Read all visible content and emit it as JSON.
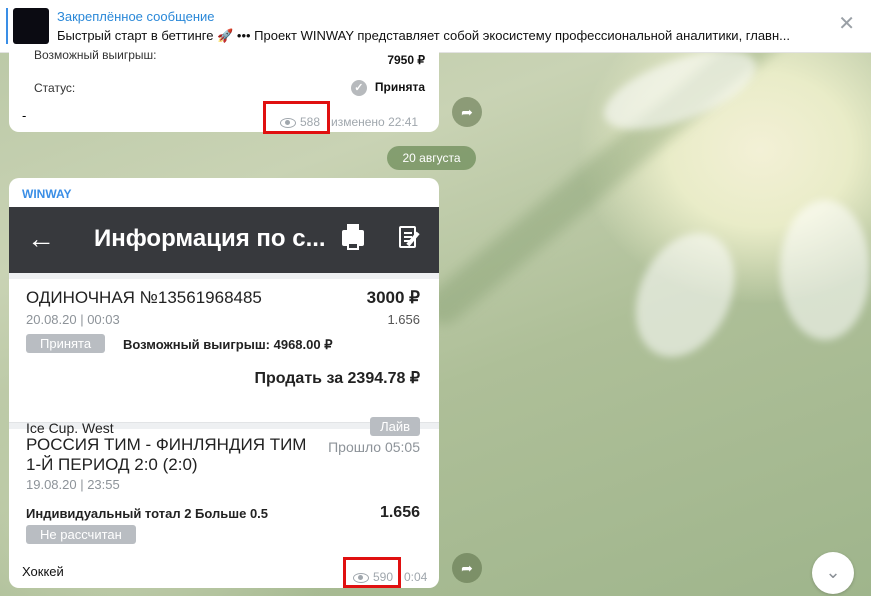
{
  "pinned": {
    "title": "Закреплённое сообщение",
    "text": "Быстрый старт в беттинге 🚀 ••• Проект WINWAY представляет собой экосистему профессиональной аналитики, главн...",
    "close_icon": "close-icon"
  },
  "msg1": {
    "potential_win_label": "Возможный выигрыш:",
    "potential_win_value": "7950 ₽",
    "status_label": "Статус:",
    "status_value": "Принята",
    "caption": "-",
    "views": "588",
    "edited": "изменено 22:41"
  },
  "date_separator": "20 августа",
  "msg2": {
    "sender": "WINWAY",
    "app_title": "Информация по с...",
    "bet_title": "ОДИНОЧНАЯ №13561968485",
    "bet_amount": "3000 ₽",
    "bet_datetime": "20.08.20 | 00:03",
    "bet_odds": "1.656",
    "status_badge": "Принята",
    "potential_win": "Возможный выигрыш: 4968.00 ₽",
    "sell_for": "Продать за 2394.78 ₽",
    "league": "Ice Cup. West",
    "live_badge": "Лайв",
    "match": "РОССИЯ ТИМ - ФИНЛЯНДИЯ ТИМ",
    "period_score": "1-Й ПЕРИОД 2:0 (2:0)",
    "elapsed": "Прошло 05:05",
    "match_datetime": "19.08.20 | 23:55",
    "market": "Индивидуальный тотал 2 Больше 0.5",
    "market_odds": "1.656",
    "result_badge": "Не рассчитан",
    "caption": "Хоккей",
    "views": "590",
    "time": "0:04"
  },
  "colors": {
    "accent": "#3a8ee6",
    "highlight": "#e01010",
    "appbar": "#37393d"
  }
}
